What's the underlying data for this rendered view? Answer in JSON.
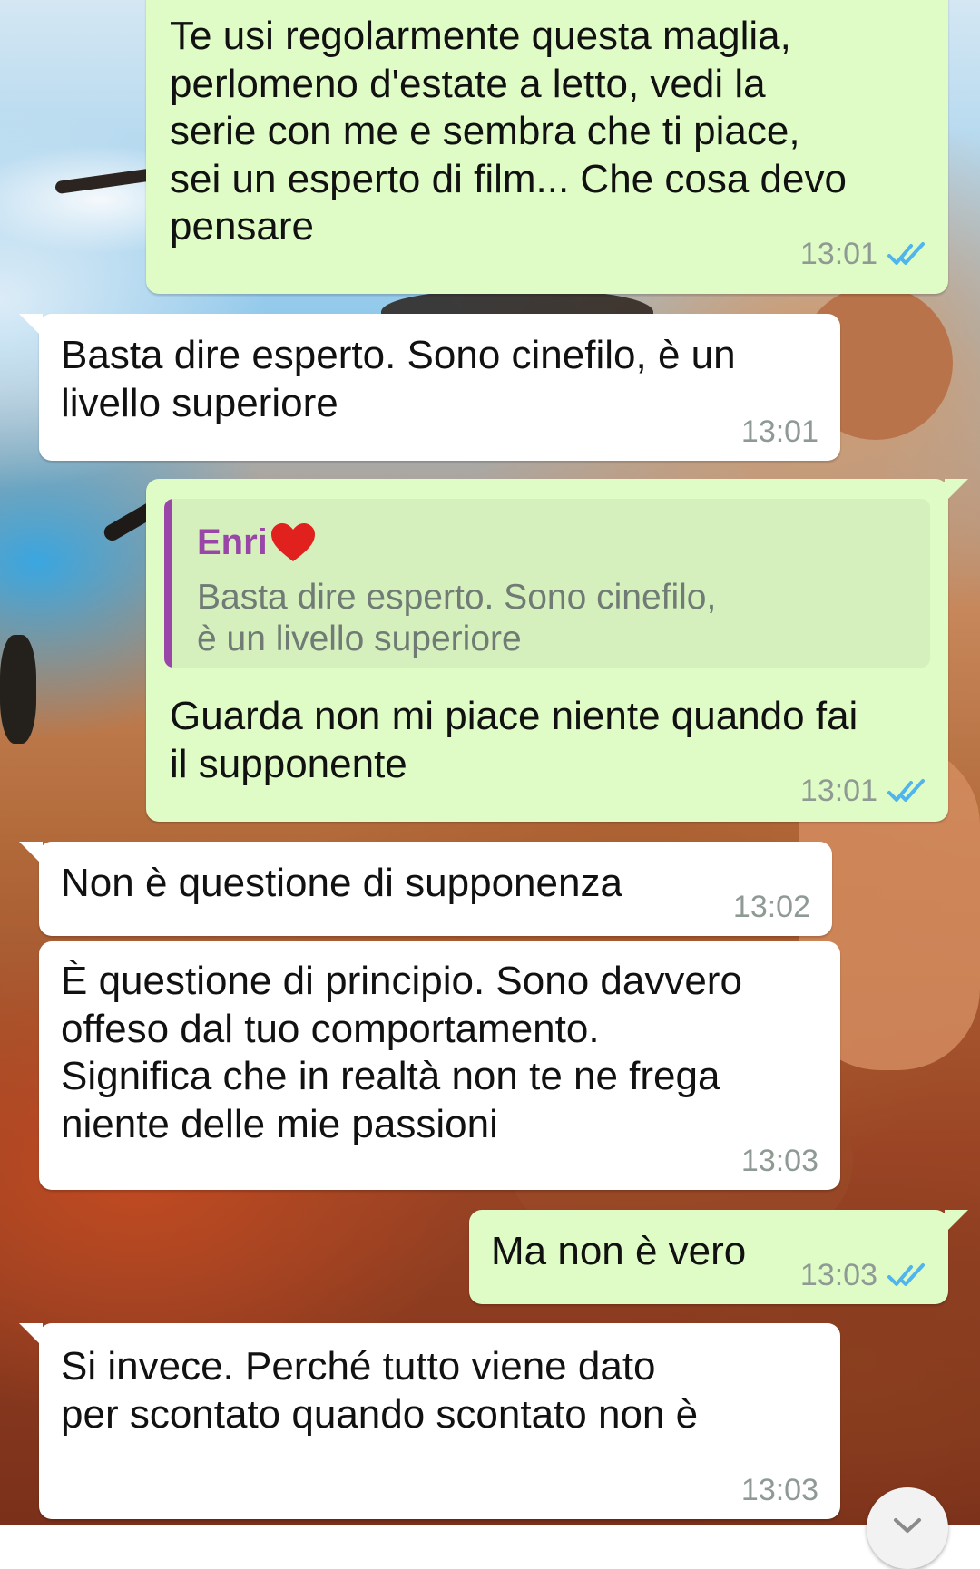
{
  "messages": [
    {
      "direction": "outgoing",
      "text": "Te usi regolarmente questa maglia,\nperlomeno d'estate a letto, vedi la\nserie con me e sembra che ti piace,\nsei un esperto di film... Che cosa devo\npensare",
      "time": "13:01",
      "status": "read"
    },
    {
      "direction": "incoming",
      "text": "Basta dire esperto. Sono cinefilo, è un\nlivello superiore",
      "time": "13:01"
    },
    {
      "direction": "outgoing",
      "quote": {
        "author": "Enri",
        "text": "Basta dire esperto. Sono cinefilo,\nè un livello superiore"
      },
      "text": "Guarda non mi piace niente quando fai\nil supponente",
      "time": "13:01",
      "status": "read"
    },
    {
      "direction": "incoming",
      "text": "Non è questione di supponenza",
      "time": "13:02"
    },
    {
      "direction": "incoming",
      "text": "È questione di principio. Sono davvero\noffeso dal tuo comportamento.\nSignifica che in realtà non te ne frega\nniente delle mie passioni",
      "time": "13:03"
    },
    {
      "direction": "outgoing",
      "text": "Ma non è vero",
      "time": "13:03",
      "status": "read"
    },
    {
      "direction": "incoming",
      "text": "Si invece. Perché tutto viene dato\nper scontato quando scontato non è",
      "time": "13:03"
    }
  ],
  "colors": {
    "outgoing_bubble": "#e0fcc6",
    "incoming_bubble": "#ffffff",
    "read_ticks": "#4fb5ec",
    "quote_author": "#9a46a8"
  },
  "icons": {
    "read_receipt": "double-check-icon",
    "quote_emoji": "heart-icon",
    "scroll_button": "scroll-down-icon"
  }
}
